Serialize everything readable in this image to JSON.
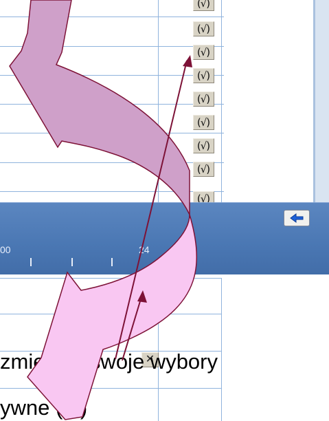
{
  "top_grid": {
    "check_label": "(√)",
    "check_count": 8
  },
  "timeline": {
    "labels": [
      "00",
      "24"
    ]
  },
  "lower_grid": {
    "x_button_label": "✕"
  },
  "caption": {
    "line1": "zmieniać swoje wybory",
    "line2": "ywne (√ )"
  },
  "colors": {
    "arrow_upper": "#cfa0c9",
    "arrow_lower": "#f9c7f2",
    "arrow_stroke": "#7d1237",
    "grid_line": "#8fb3dd",
    "time_bar": "#4a77b3"
  },
  "icons": {
    "back": "left-arrow-icon",
    "check": "checkmark-icon",
    "close": "close-icon"
  }
}
